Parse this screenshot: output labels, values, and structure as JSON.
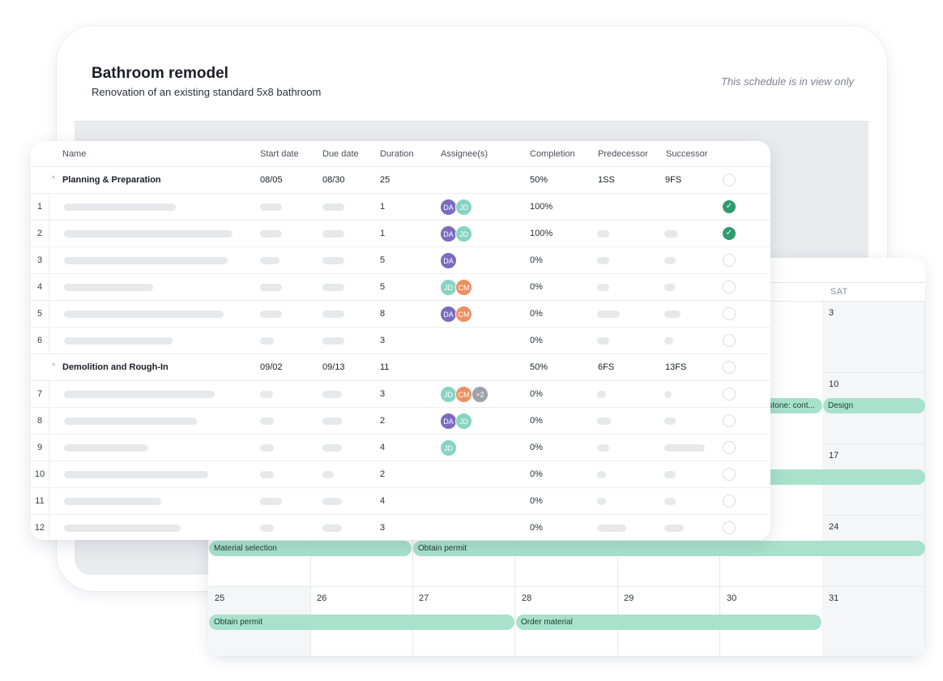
{
  "project": {
    "title": "Bathroom remodel",
    "subtitle": "Renovation of an existing standard 5x8 bathroom",
    "view_note": "This schedule is in view only"
  },
  "table": {
    "columns": [
      "Name",
      "Start date",
      "Due date",
      "Duration",
      "Assignee(s)",
      "Completion",
      "Predecessor",
      "Successor"
    ],
    "groups": [
      {
        "name": "Planning & Preparation",
        "start": "08/05",
        "due": "08/30",
        "duration": "25",
        "completion": "50%",
        "predecessor": "1SS",
        "successor": "9FS"
      },
      {
        "name": "Demolition and Rough-In",
        "start": "09/02",
        "due": "09/13",
        "duration": "11",
        "completion": "50%",
        "predecessor": "6FS",
        "successor": "13FS"
      }
    ],
    "tasks": [
      {
        "num": "1",
        "duration": "1",
        "assignees": [
          "DA",
          "JD"
        ],
        "completion": "100%",
        "done": true
      },
      {
        "num": "2",
        "duration": "1",
        "assignees": [
          "DA",
          "JD"
        ],
        "completion": "100%",
        "done": true
      },
      {
        "num": "3",
        "duration": "5",
        "assignees": [
          "DA"
        ],
        "completion": "0%",
        "done": false
      },
      {
        "num": "4",
        "duration": "5",
        "assignees": [
          "JD",
          "CM"
        ],
        "completion": "0%",
        "done": false
      },
      {
        "num": "5",
        "duration": "8",
        "assignees": [
          "DA",
          "CM"
        ],
        "completion": "0%",
        "done": false
      },
      {
        "num": "6",
        "duration": "3",
        "assignees": [],
        "completion": "0%",
        "done": false
      },
      {
        "num": "7",
        "duration": "3",
        "assignees": [
          "JD",
          "CM",
          "+2"
        ],
        "completion": "0%",
        "done": false
      },
      {
        "num": "8",
        "duration": "2",
        "assignees": [
          "DA",
          "JD"
        ],
        "completion": "0%",
        "done": false
      },
      {
        "num": "9",
        "duration": "4",
        "assignees": [
          "JD"
        ],
        "completion": "0%",
        "done": false
      },
      {
        "num": "10",
        "duration": "2",
        "assignees": [],
        "completion": "0%",
        "done": false
      },
      {
        "num": "11",
        "duration": "4",
        "assignees": [],
        "completion": "0%",
        "done": false
      },
      {
        "num": "12",
        "duration": "3",
        "assignees": [],
        "completion": "0%",
        "done": false
      }
    ],
    "done_mark": "✓",
    "collapse_mark": "^"
  },
  "calendar": {
    "visible_dow": "SAT",
    "days": [
      "3",
      "10",
      "17",
      "24",
      "25",
      "26",
      "27",
      "28",
      "29",
      "30",
      "31"
    ],
    "bars": [
      "estone: cont...",
      "Design",
      "Material selection",
      "Obtain permit",
      "Obtain permit",
      "Order material"
    ]
  },
  "colors": {
    "avatar_da": "#7b6bbf",
    "avatar_jd": "#86d4c2",
    "avatar_cm": "#ee8f62",
    "avatar_more": "#9ca1ab",
    "complete_check": "#2f9c6e",
    "calendar_bar": "#a8e2cc"
  }
}
